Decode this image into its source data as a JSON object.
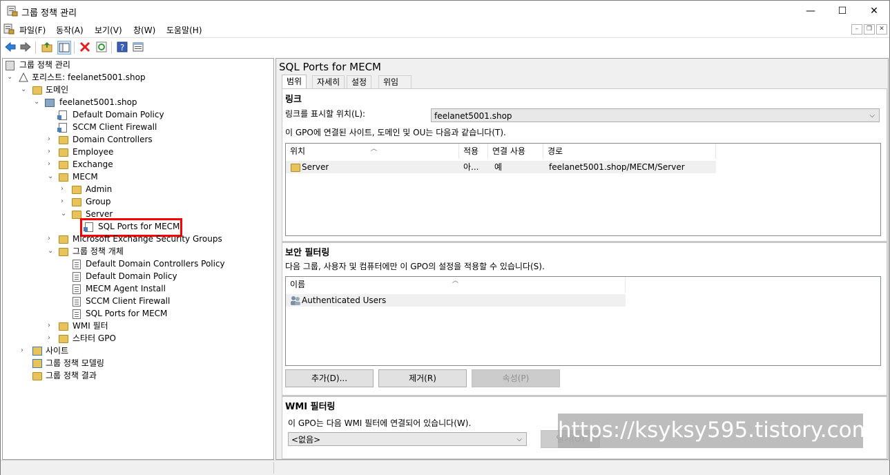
{
  "window": {
    "title": "그룹 정책 관리",
    "minimize_glyph": "—",
    "maximize_glyph": "☐",
    "close_glyph": "✕"
  },
  "menu": {
    "items": [
      "파일(F)",
      "동작(A)",
      "보기(V)",
      "창(W)",
      "도움말(H)"
    ],
    "mdi_min": "–",
    "mdi_restore": "❐",
    "mdi_close": "✕"
  },
  "toolbar": {
    "icons": [
      "back-arrow-icon",
      "forward-arrow-icon",
      "up-folder-icon",
      "show-hide-tree-icon",
      "delete-icon",
      "refresh-icon",
      "help-icon",
      "properties-icon"
    ]
  },
  "tree": {
    "root": "그룹 정책 관리",
    "forest": "포리스트: feelanet5001.shop",
    "domains": "도메인",
    "domain": "feelanet5001.shop",
    "links": [
      "Default Domain Policy",
      "SCCM Client Firewall"
    ],
    "ous": [
      "Domain Controllers",
      "Employee",
      "Exchange",
      "MECM"
    ],
    "mecm_children": [
      "Admin",
      "Group",
      "Server"
    ],
    "server_link": "SQL Ports for MECM",
    "ms_exchange": "Microsoft Exchange Security Groups",
    "gpo_container": "그룹 정책 개체",
    "gpos": [
      "Default Domain Controllers Policy",
      "Default Domain Policy",
      "MECM Agent Install",
      "SCCM Client Firewall",
      "SQL Ports for MECM"
    ],
    "wmi_filters": "WMI 필터",
    "starter_gpo": "스타터 GPO",
    "sites": "사이트",
    "modeling": "그룹 정책 모델링",
    "results": "그룹 정책 결과"
  },
  "details": {
    "title": "SQL Ports for MECM",
    "tabs": [
      "범위",
      "자세히",
      "설정",
      "위임"
    ],
    "links": {
      "heading": "링크",
      "location_label": "링크를 표시할 위치(L):",
      "location_value": "feelanet5001.shop",
      "description": "이 GPO에 연결된 사이트, 도메인 및 OU는 다음과 같습니다(T).",
      "columns": [
        "위치",
        "적용",
        "연결 사용",
        "경로"
      ],
      "rows": [
        {
          "location": "Server",
          "enforced": "아...",
          "link_enabled": "예",
          "path": "feelanet5001.shop/MECM/Server"
        }
      ]
    },
    "security": {
      "heading": "보안 필터링",
      "description": "다음 그룹, 사용자 및 컴퓨터에만 이 GPO의 설정을 적용할 수 있습니다(S).",
      "columns": [
        "이름"
      ],
      "rows": [
        "Authenticated Users"
      ],
      "add_button": "추가(D)...",
      "remove_button": "제거(R)",
      "properties_button": "속성(P)"
    },
    "wmi": {
      "heading": "WMI 필터링",
      "description": "이 GPO는 다음 WMI 필터에 연결되어 있습니다(W).",
      "value": "<없음>",
      "open_button": "열기(O)"
    }
  },
  "watermark": "https://ksyksy595.tistory.com"
}
